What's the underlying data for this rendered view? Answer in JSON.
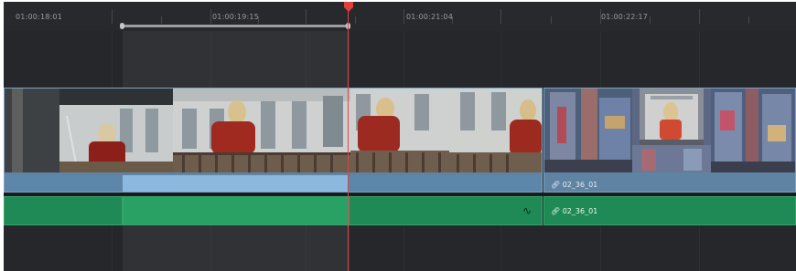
{
  "timeline": {
    "ruler_timecodes": [
      "01:00:18:01",
      "01:00:19:15",
      "01:00:21:04",
      "01:00:22:17"
    ],
    "video_clips": [
      {
        "name": "",
        "frames": [
          "girl-pushing-shutter",
          "girl-at-railing",
          "girl-turning",
          "girl-looking-back"
        ]
      },
      {
        "name": "02_36_01",
        "frames": [
          "graffiti-wall",
          "girl-at-graffiti-window",
          "graffiti-wall-right"
        ]
      }
    ],
    "audio_clips": [
      {
        "name": "",
        "handle_icon": "audio-fade-icon"
      },
      {
        "name": "02_36_01"
      }
    ],
    "link_icon": "link-icon",
    "playhead_icon": "playhead-marker-icon",
    "colors": {
      "background": "#26272a",
      "video_clip": "#5e83a3",
      "video_clip_selected": "#8bb8de",
      "audio_clip": "#1f8a55",
      "audio_clip_selected": "#2aa164",
      "playhead": "#d44a45"
    }
  }
}
